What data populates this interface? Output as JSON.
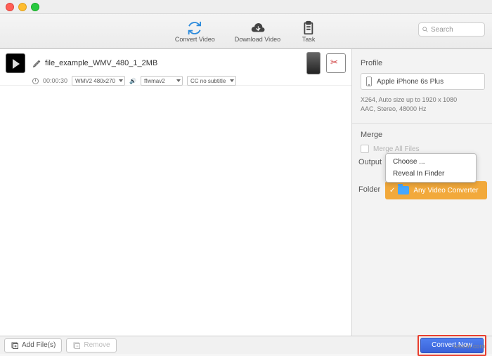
{
  "toolbar": {
    "convert": "Convert Video",
    "download": "Download Video",
    "task": "Task",
    "search_placeholder": "Search"
  },
  "file": {
    "name": "file_example_WMV_480_1_2MB",
    "duration": "00:00:30",
    "codec": "WMV2 480x270",
    "audio": "ffwmav2",
    "subtitle": "CC no subtitle"
  },
  "sidebar": {
    "profile_title": "Profile",
    "profile_value": "Apple iPhone 6s Plus",
    "profile_info1": "X264, Auto size up to 1920 x 1080",
    "profile_info2": "AAC, Stereo, 48000 Hz",
    "merge_title": "Merge",
    "merge_label": "Merge All Files",
    "output_title": "Output",
    "folder_label": "Folder"
  },
  "ctx": {
    "choose": "Choose ...",
    "reveal": "Reveal In Finder",
    "current": "Any Video Converter"
  },
  "bottom": {
    "add": "Add File(s)",
    "remove": "Remove",
    "convert": "Convert Now"
  },
  "watermark": "wsxdn.com"
}
